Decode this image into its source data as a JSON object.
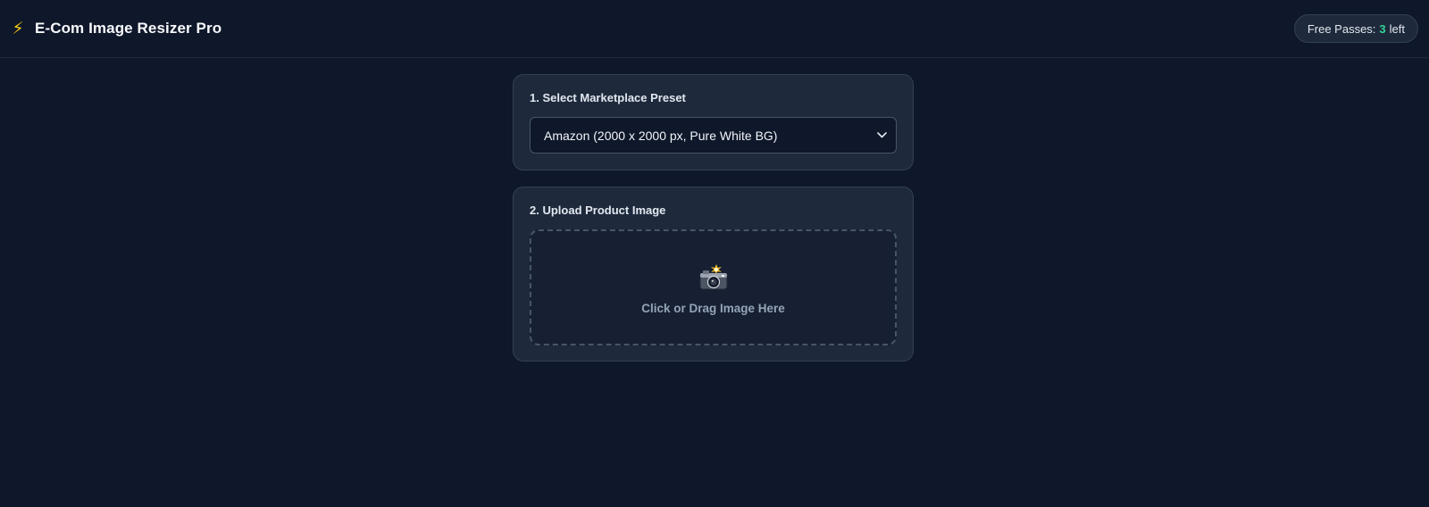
{
  "header": {
    "title": "E-Com Image Resizer Pro",
    "icon": "lightning-bolt-icon",
    "free_passes": {
      "prefix": "Free Passes:",
      "count": "3",
      "suffix": "left"
    }
  },
  "preset_section": {
    "label": "1. Select Marketplace Preset",
    "selected": "Amazon (2000 x 2000 px, Pure White BG)"
  },
  "upload_section": {
    "label": "2. Upload Product Image",
    "dropzone_text": "Click or Drag Image Here",
    "icon": "camera-flash-icon"
  },
  "colors": {
    "background": "#0f172a",
    "card": "#1e293b",
    "accent_count": "#34d399",
    "bolt": "#facc15"
  }
}
